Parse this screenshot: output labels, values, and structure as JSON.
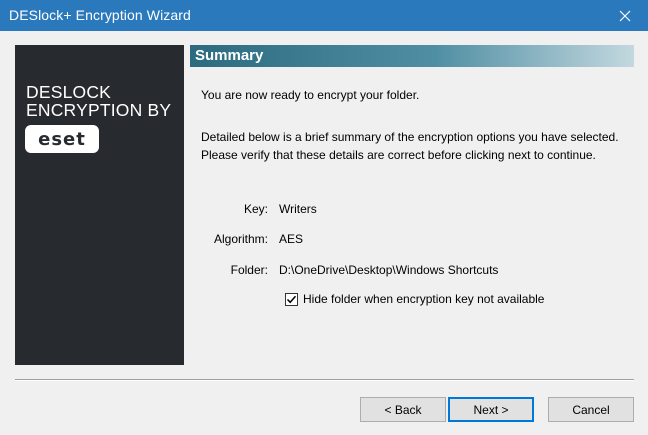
{
  "window": {
    "title": "DESlock+ Encryption Wizard",
    "close_icon": "close-icon"
  },
  "brand": {
    "line1": "DESLOCK",
    "line2": "ENCRYPTION BY",
    "logo_text": "eset"
  },
  "header": {
    "title": "Summary"
  },
  "content": {
    "ready_text": "You are now ready to encrypt your folder.",
    "detail_line1": "Detailed below is a brief summary of the encryption options you have selected.",
    "detail_line2": "Please verify that these details are correct before clicking next to continue."
  },
  "summary": {
    "key_label": "Key:",
    "key_value": "Writers",
    "algorithm_label": "Algorithm:",
    "algorithm_value": "AES",
    "folder_label": "Folder:",
    "folder_value": "D:\\OneDrive\\Desktop\\Windows Shortcuts"
  },
  "options": {
    "hide_folder_label": "Hide folder when encryption key not available",
    "hide_folder_checked": true
  },
  "buttons": {
    "back": "< Back",
    "next": "Next >",
    "cancel": "Cancel"
  },
  "colors": {
    "titlebar": "#2b79bd",
    "side_panel": "#272b2f",
    "header_start": "#2c6a80",
    "header_end": "#c3d8df",
    "focus_border": "#0078d7"
  }
}
